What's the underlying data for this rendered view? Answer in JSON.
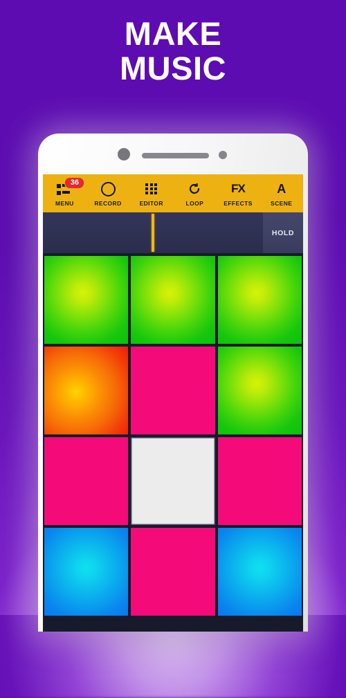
{
  "background": {
    "base_color": "#5c0bb0",
    "glow_color": "#e9c6ff"
  },
  "headline": {
    "line1": "MAKE",
    "line2": "MUSIC",
    "color": "#ffffff"
  },
  "phone": {
    "frame_color": "#f4f4f4",
    "hardware": {
      "camera": "camera-lens",
      "speaker": "earpiece-speaker",
      "sensor": "proximity-sensor"
    }
  },
  "app": {
    "toolbar": {
      "background": "#edb212",
      "items": [
        {
          "label": "MENU",
          "icon": "menu-list-icon",
          "badge": "36"
        },
        {
          "label": "RECORD",
          "icon": "record-circle-icon",
          "badge": null
        },
        {
          "label": "EDITOR",
          "icon": "grid-9-icon",
          "badge": null
        },
        {
          "label": "LOOP",
          "icon": "loop-arrow-icon",
          "badge": null
        },
        {
          "label": "EFFECTS",
          "icon": "fx-text-icon",
          "badge": null,
          "glyph_text": "FX"
        },
        {
          "label": "SCENE",
          "icon": "scene-letter-icon",
          "badge": null,
          "glyph_text": "A"
        }
      ],
      "badge_color": "#e8272a"
    },
    "timeline": {
      "background": "#2e3152",
      "playhead_color": "#f0b90d",
      "hold_label": "HOLD"
    },
    "pad_grid": {
      "columns": 3,
      "rows": 4,
      "gap_color": "#171a2b",
      "colors": {
        "green": "#41d40b",
        "orange": "#f66a07",
        "pink": "#f50a79",
        "white": "#ececec",
        "blue": "#0a9eee"
      },
      "pads": [
        {
          "id": "pad-1",
          "color": "green",
          "style": "radial"
        },
        {
          "id": "pad-2",
          "color": "green",
          "style": "radial"
        },
        {
          "id": "pad-3",
          "color": "green",
          "style": "radial"
        },
        {
          "id": "pad-4",
          "color": "orange",
          "style": "radial"
        },
        {
          "id": "pad-5",
          "color": "pink",
          "style": "flat"
        },
        {
          "id": "pad-6",
          "color": "green",
          "style": "radial"
        },
        {
          "id": "pad-7",
          "color": "pink",
          "style": "flat"
        },
        {
          "id": "pad-8",
          "color": "white",
          "style": "flat"
        },
        {
          "id": "pad-9",
          "color": "pink",
          "style": "flat"
        },
        {
          "id": "pad-10",
          "color": "blue",
          "style": "radial"
        },
        {
          "id": "pad-11",
          "color": "pink",
          "style": "flat"
        },
        {
          "id": "pad-12",
          "color": "blue",
          "style": "radial"
        }
      ]
    }
  }
}
